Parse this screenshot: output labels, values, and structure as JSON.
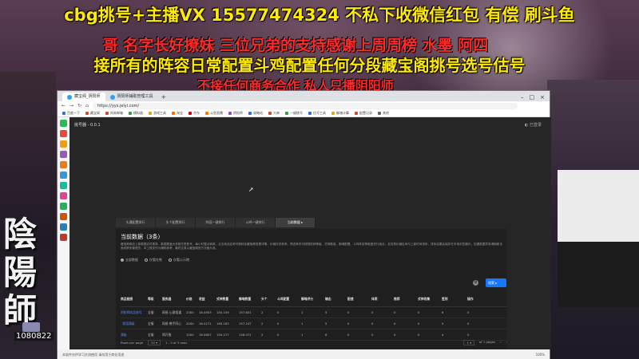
{
  "overlay": {
    "line1": "cbg挑号+主播VX 15577474324 不私下收微信红包 有偿 刷斗鱼",
    "line2": "哥 名字长好撩妹  三位兄弟的支持感谢上周周榜 水墨  阿四",
    "line3": "接所有的阵容日常配置斗鸡配置任何分段藏宝阁挑号选号估号",
    "line4": "不接任何商务合作 私人只播阴阳师",
    "calligraphy": "陰陽師",
    "streamer_id": "1080822"
  },
  "browser": {
    "tabs": [
      {
        "label": "藏宝阁_阴阳师"
      },
      {
        "label": "阴阳师辅助管理工具"
      }
    ],
    "new_tab": "+",
    "window_controls": [
      "–",
      "□",
      "×"
    ],
    "url": "https://yys.jelyi.com/",
    "bookmarks": [
      {
        "label": "百度一下",
        "color": "#2f6fd6"
      },
      {
        "label": "藏宝阁",
        "color": "#d04a3c"
      },
      {
        "label": "网易邮箱",
        "color": "#d04a3c"
      },
      {
        "label": "模拟器",
        "color": "#3b9b4b"
      },
      {
        "label": "游戏工具",
        "color": "#e3a21a"
      },
      {
        "label": "淘宝",
        "color": "#ff6a00"
      },
      {
        "label": "京东",
        "color": "#d0021b"
      },
      {
        "label": "斗鱼直播",
        "color": "#ff7700"
      },
      {
        "label": "阴阳师",
        "color": "#8a4fd6"
      },
      {
        "label": "攻略站",
        "color": "#2f6fd6"
      },
      {
        "label": "大神",
        "color": "#d04a3c"
      },
      {
        "label": "一键挑号",
        "color": "#3b9b4b"
      },
      {
        "label": "估号工具",
        "color": "#2f6fd6"
      },
      {
        "label": "御魂计算",
        "color": "#e3a21a"
      },
      {
        "label": "配置记录",
        "color": "#d04a3c"
      },
      {
        "label": "其他",
        "color": "#666666"
      }
    ],
    "status_text": "本软件仅供学习交流使用 请勿用于商业用途",
    "zoom": "100%"
  },
  "sidebar_icons": [
    {
      "name": "chat-icon",
      "color": "#2dbb5a"
    },
    {
      "name": "mail-icon",
      "color": "#e74c3c"
    },
    {
      "name": "shop-icon",
      "color": "#f39c12"
    },
    {
      "name": "game-icon",
      "color": "#9b59b6"
    },
    {
      "name": "video-icon",
      "color": "#e67e22"
    },
    {
      "name": "cloud-icon",
      "color": "#3498db"
    },
    {
      "name": "note-icon",
      "color": "#1abc9c"
    },
    {
      "name": "music-icon",
      "color": "#e84393"
    },
    {
      "name": "map-icon",
      "color": "#27ae60"
    },
    {
      "name": "photo-icon",
      "color": "#d35400"
    },
    {
      "name": "doc-icon",
      "color": "#2980b9"
    },
    {
      "name": "tool-icon",
      "color": "#c0392b"
    }
  ],
  "app": {
    "title": "挑号器 - 0.0.1",
    "status": "◐ 已登录"
  },
  "main_tabs": [
    {
      "label": "头通配置排行",
      "active": false
    },
    {
      "label": "头个配置排行",
      "active": false
    },
    {
      "label": "阵容一键排行",
      "active": false
    },
    {
      "label": "斗鸡一键排行",
      "active": false
    },
    {
      "label": "当前数据 ▸",
      "active": true
    }
  ],
  "panel": {
    "title": "当前数据（3条）",
    "description": "藏宝阁商品上架数据实时更新，数据覆盖大多数在售账号，每小时整点刷新。点击商品名称可跳转至藏宝阁查看详情，价格仅供参考。筛选条件可按阴阳师等级、式神数量、御魂配置、斗鸡阵容等维度进行组合；支持按价格区间与上架时间排序，排序结果会保存在本地浏览器中。如遇数据异常请刷新页面或联系管理员，本工具仅作为辅助参考，最终交易以藏宝阁官方页面为准。",
    "radios": [
      {
        "label": "全部数据",
        "on": true
      },
      {
        "label": "仅看在售",
        "on": false
      },
      {
        "label": "仅看公示期",
        "on": false
      }
    ],
    "gear_icon": "⚙",
    "search_button": "搜索 ▸",
    "columns": [
      "商品链接",
      "等级",
      "服务器",
      "价格",
      "收益",
      "式神数量",
      "御魂数量",
      "头个",
      "斗鸡配置",
      "御魂评分",
      "输出",
      "配速",
      "体质",
      "推荐",
      "式神收集",
      "签到",
      "操作"
    ],
    "rows": [
      [
        "阴阳师成品账号",
        "全服",
        "网易·心意相通",
        "2300",
        "16.4953",
        "150.159",
        "157.631",
        "2",
        "0",
        "1",
        "5",
        "0",
        "0",
        "0",
        "0",
        "6",
        "0"
      ],
      [
        "· 爬塔满级",
        "全服",
        "网易·携手同心",
        "2000",
        "16.4271",
        "165.163",
        "157.247",
        "2",
        "0",
        "1",
        "5",
        "0",
        "0",
        "0",
        "0",
        "5",
        "0"
      ],
      [
        "满级",
        "全服",
        "两开服",
        "1500",
        "16.9807",
        "150.277",
        "158.071",
        "2",
        "0",
        "1",
        "6",
        "0",
        "0",
        "0",
        "0",
        "4",
        "0"
      ]
    ],
    "pager": {
      "rows_per_page_label": "Rows per page",
      "rows_per_page": "20 ▾",
      "range": "1 - 3 of 3 rows",
      "page_select": "1 ▾",
      "page_info": "of 1 pages",
      "prev": "‹",
      "next": "›"
    }
  }
}
